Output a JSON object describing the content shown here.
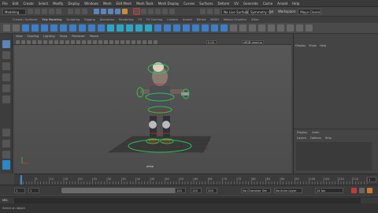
{
  "menubar": {
    "items": [
      "File",
      "Edit",
      "Create",
      "Select",
      "Modify",
      "Display",
      "Windows",
      "Mesh",
      "Edit Mesh",
      "Mesh Tools",
      "Mesh Display",
      "Curves",
      "Surfaces",
      "Deform",
      "UV",
      "Generate",
      "Cache",
      "Arnold",
      "Help"
    ]
  },
  "statusline": {
    "mode_select": "Modeling",
    "live_surface": "No Live Surface",
    "symmetry": "Symmetry: Off",
    "workspace_label": "Workspace:",
    "workspace_value": "Maya Classic"
  },
  "shelf": {
    "tabs": [
      "Curves / Surfaces",
      "Poly Modeling",
      "Sculpting",
      "Rigging",
      "Animation",
      "Rendering",
      "FX",
      "FX Caching",
      "Custom",
      "Arnold",
      "Bifrost",
      "MASH",
      "Motion Graphics",
      "XGen"
    ]
  },
  "panel": {
    "menu": [
      "View",
      "Shading",
      "Lighting",
      "Show",
      "Renderer",
      "Panels"
    ],
    "field_value": "0.00",
    "colorspace": "sRGB gamma",
    "camera_label": "persp"
  },
  "outliner": {
    "tabs": [
      "Display",
      "Show",
      "Help"
    ],
    "channel_tabs": [
      "Display",
      "Anim"
    ],
    "channel_menu": [
      "Layers",
      "Options",
      "Help"
    ]
  },
  "timeline": {
    "ticks": [
      "5",
      "10",
      "15",
      "20",
      "25",
      "30",
      "35",
      "40",
      "45",
      "50",
      "55",
      "60",
      "65",
      "70",
      "75",
      "80",
      "85",
      "90",
      "95",
      "100",
      "105",
      "110",
      "115",
      "120"
    ],
    "current_frame": "1"
  },
  "range": {
    "start": "1",
    "start_inner": "1",
    "end_inner": "120",
    "end": "120",
    "end2": "200",
    "character_set": "No Character Set",
    "anim_layer": "No Anim Layer",
    "fps": "24 fps"
  },
  "command": {
    "label": "MEL"
  },
  "help": {
    "text": "Select an object"
  },
  "colors": {
    "accent_blue": "#3b7ec9",
    "selection_green": "#30c050",
    "highlight_red": "#e03030"
  }
}
